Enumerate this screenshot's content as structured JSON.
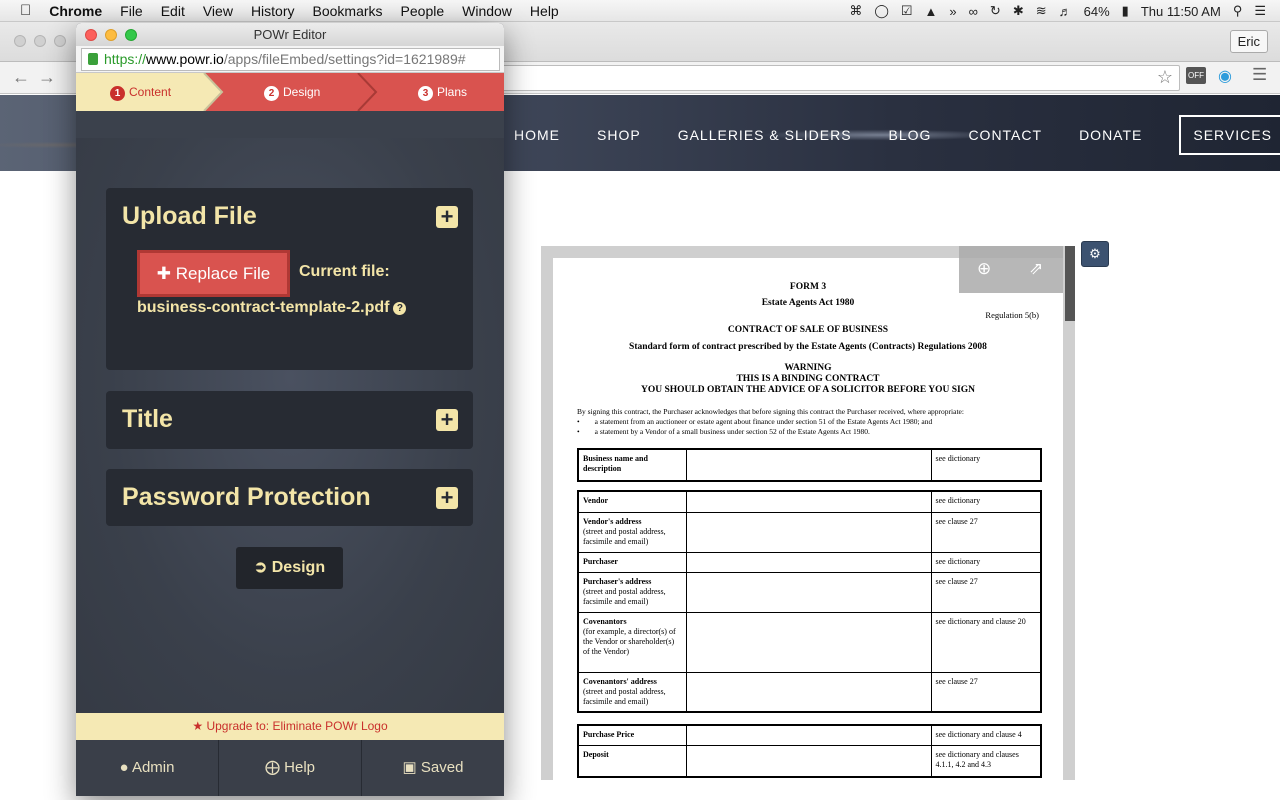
{
  "menubar": {
    "apple": "",
    "app_name": "Chrome",
    "items": [
      "File",
      "Edit",
      "View",
      "History",
      "Bookmarks",
      "People",
      "Window",
      "Help"
    ],
    "battery": "64%",
    "clock": "Thu 11:50 AM"
  },
  "browser": {
    "profile": "Eric",
    "ext_off": "OFF"
  },
  "site": {
    "nav": [
      "HOME",
      "SHOP",
      "GALLERIES & SLIDERS",
      "BLOG",
      "CONTACT",
      "DONATE",
      "SERVICES"
    ]
  },
  "pdf": {
    "form": "FORM 3",
    "act": "Estate Agents Act 1980",
    "regulation": "Regulation 5(b)",
    "contract_title": "CONTRACT OF SALE OF BUSINESS",
    "standard": "Standard form of contract prescribed by the Estate Agents (Contracts) Regulations 2008",
    "warning1": "WARNING",
    "warning2": "THIS IS A BINDING CONTRACT",
    "warning3": "YOU SHOULD OBTAIN THE ADVICE OF A SOLICITOR BEFORE YOU SIGN",
    "intro": "By signing this contract, the Purchaser acknowledges that before signing this contract the Purchaser received, where appropriate:",
    "bullet1": "a statement from an auctioneer or estate agent about finance under section 51 of the Estate Agents Act 1980; and",
    "bullet2": "a statement by a Vendor of a small business under section 52 of the Estate Agents Act 1980.",
    "table1": [
      {
        "label": "Business name and description",
        "sub": "",
        "ref": "see dictionary"
      }
    ],
    "table2": [
      {
        "label": "Vendor",
        "sub": "",
        "ref": "see dictionary"
      },
      {
        "label": "Vendor's address",
        "sub": "(street and postal address, facsimile and email)",
        "ref": "see clause 27"
      },
      {
        "label": "Purchaser",
        "sub": "",
        "ref": "see dictionary"
      },
      {
        "label": "Purchaser's address",
        "sub": "(street and postal address, facsimile and email)",
        "ref": "see clause 27"
      },
      {
        "label": "Covenantors",
        "sub": "(for example, a director(s) of the Vendor or shareholder(s) of the Vendor)",
        "ref": "see dictionary and clause 20"
      },
      {
        "label": "Covenantors' address",
        "sub": "(street and postal address, facsimile and email)",
        "ref": "see clause 27"
      }
    ],
    "table3": [
      {
        "label": "Purchase Price",
        "sub": "",
        "ref": "see dictionary and clause 4"
      },
      {
        "label": "Deposit",
        "sub": "",
        "ref": "see dictionary and clauses 4.1.1, 4.2 and 4.3"
      }
    ]
  },
  "editor": {
    "window_title": "POWr Editor",
    "url_scheme": "https://",
    "url_host": "www.powr.io",
    "url_path": "/apps/fileEmbed/settings?id=1621989#",
    "steps": [
      {
        "num": "1",
        "label": "Content"
      },
      {
        "num": "2",
        "label": "Design"
      },
      {
        "num": "3",
        "label": "Plans"
      }
    ],
    "upload": {
      "title": "Upload File",
      "replace_label": "Replace File",
      "current_label": "Current file:",
      "file_name": "business-contract-template-2.pdf"
    },
    "title_panel": "Title",
    "password_panel": "Password Protection",
    "design_button": "Design",
    "upgrade": "Upgrade to: Eliminate POWr Logo",
    "footer": {
      "admin": "Admin",
      "help": "Help",
      "saved": "Saved"
    }
  }
}
